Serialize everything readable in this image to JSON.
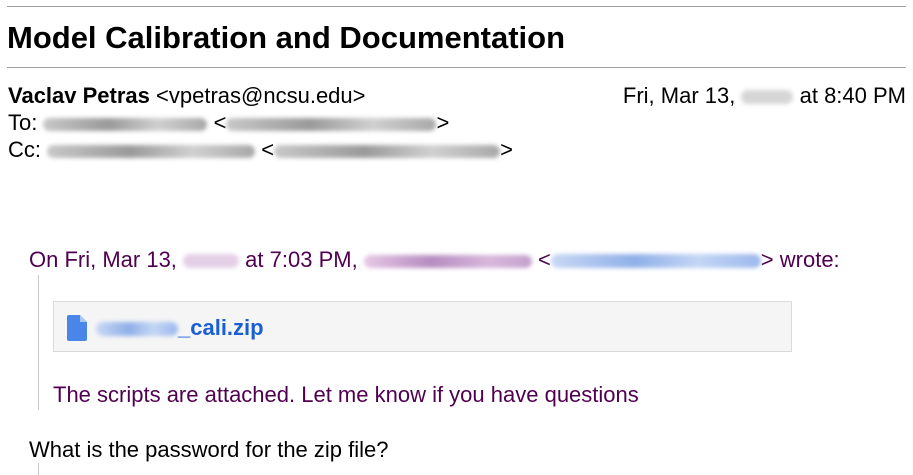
{
  "email": {
    "subject": "Model Calibration and Documentation",
    "from_name": "Vaclav Petras",
    "from_email": "<vpetras@ncsu.edu>",
    "date_prefix": "Fri, Mar 13,",
    "date_suffix": "at 8:40 PM",
    "to_label": "To:",
    "cc_label": "Cc:",
    "angle_open": "<",
    "angle_close": ">"
  },
  "quote": {
    "attr_prefix": "On Fri, Mar 13,",
    "attr_time": "at 7:03 PM,",
    "attr_lt": "<",
    "attr_suffix": "> wrote:",
    "attachment_name_suffix": "_cali.zip",
    "attachment_icon": "file-icon",
    "body": "The scripts are attached. Let me know if you have questions"
  },
  "reply": {
    "text": "What is the password for the zip file?"
  },
  "colors": {
    "quote_text": "#500050",
    "attachment_link": "#1a5fd1",
    "attachment_bg": "#f5f5f5"
  }
}
